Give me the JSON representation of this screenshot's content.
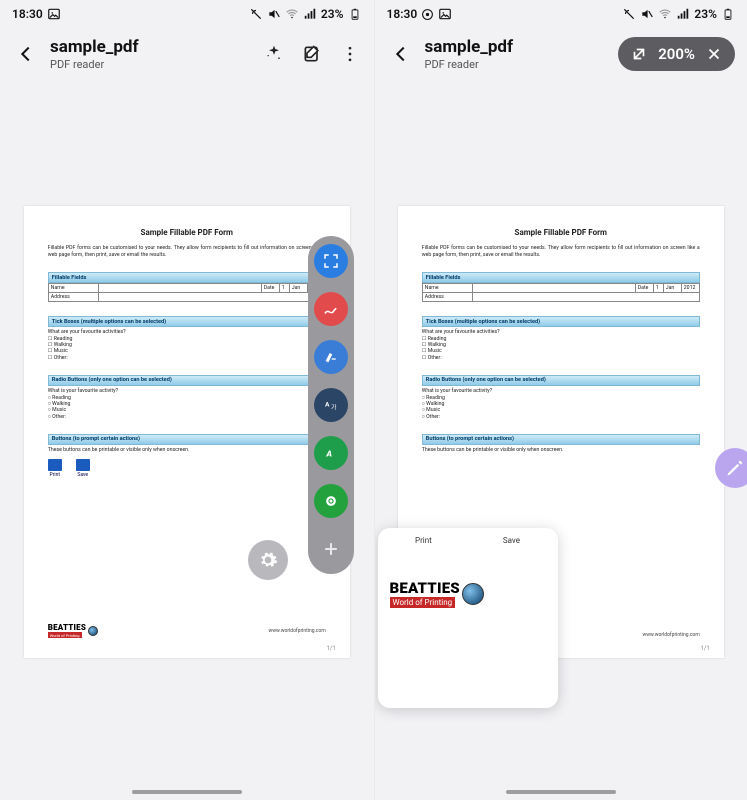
{
  "status": {
    "time": "18:30",
    "battery": "23%"
  },
  "header": {
    "title": "sample_pdf",
    "subtitle": "PDF reader"
  },
  "zoom": {
    "level": "200%"
  },
  "doc": {
    "title": "Sample Fillable PDF Form",
    "intro": "Fillable PDF forms can be customised to your needs. They allow form recipients to fill out information on screen like a web page form, then print, save or email the results.",
    "fillable": {
      "band": "Fillable Fields",
      "nameLabel": "Name",
      "addressLabel": "Address",
      "dateLabel": "Date",
      "day": "1",
      "month": "Jan",
      "year": "2012"
    },
    "tick": {
      "band": "Tick Boxes (multiple options can be selected)",
      "question": "What are your favourite activities?",
      "opts": [
        "Reading",
        "Walking",
        "Music",
        "Other:"
      ]
    },
    "radio": {
      "band": "Radio Buttons (only one option can be selected)",
      "question": "What is your favourite activity?",
      "opts": [
        "Reading",
        "Walking",
        "Music",
        "Other:"
      ]
    },
    "buttons": {
      "band": "Buttons (to prompt certain actions)",
      "note": "These buttons can be printable or visible only when onscreen.",
      "printLabel": "Print",
      "saveLabel": "Save"
    },
    "footer": {
      "brand": "BEATTIES",
      "brandSub": "World of Printing",
      "url": "www.worldofprinting.com",
      "pageNum": "1/1"
    }
  }
}
